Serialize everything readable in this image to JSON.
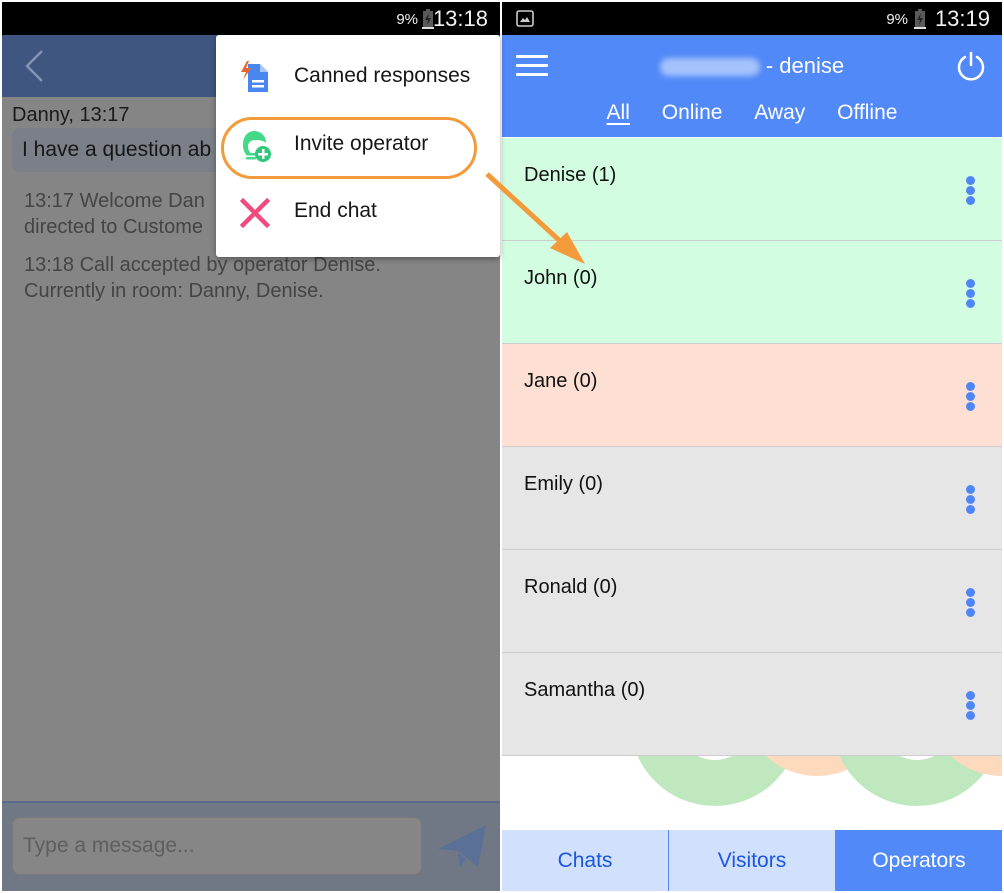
{
  "colors": {
    "accent": "#5289f8",
    "highlight_orange": "#f39a3a",
    "online_row": "#d3fde1",
    "away_row": "#fde0d3",
    "offline_row": "#e6e6e6",
    "dim_overlay": "#858585"
  },
  "left_screen": {
    "status_bar": {
      "battery": "9%",
      "time": "13:18"
    },
    "header": {
      "back_icon": "chevron-left-icon"
    },
    "chat": {
      "sender": "Danny, 13:17",
      "visitor_message": "I have a question ab",
      "system_messages": [
        {
          "line1": "13:17 Welcome Dan",
          "line2": "directed to Custome"
        },
        {
          "line1": "13:18 Call accepted by operator Denise.",
          "line2": "Currently in room: Danny, Denise."
        }
      ]
    },
    "composer": {
      "placeholder": "Type a message...",
      "send_icon": "paper-plane-icon"
    },
    "menu": {
      "items": [
        {
          "label": "Canned responses",
          "icon": "canned-responses-icon"
        },
        {
          "label": "Invite operator",
          "icon": "invite-operator-icon",
          "highlighted": true
        },
        {
          "label": "End chat",
          "icon": "close-x-icon"
        }
      ]
    }
  },
  "right_screen": {
    "status_bar": {
      "battery": "9%",
      "time": "13:19",
      "notification_icon": "image-icon"
    },
    "header": {
      "title_suffix": "- denise",
      "menu_icon": "hamburger-icon",
      "power_icon": "power-icon"
    },
    "filters": [
      {
        "label": "All",
        "active": true
      },
      {
        "label": "Online",
        "active": false
      },
      {
        "label": "Away",
        "active": false
      },
      {
        "label": "Offline",
        "active": false
      }
    ],
    "operators": [
      {
        "name": "Denise (1)",
        "status": "online"
      },
      {
        "name": "John (0)",
        "status": "online"
      },
      {
        "name": "Jane (0)",
        "status": "away"
      },
      {
        "name": "Emily (0)",
        "status": "offline"
      },
      {
        "name": "Ronald (0)",
        "status": "offline"
      },
      {
        "name": "Samantha (0)",
        "status": "offline"
      }
    ],
    "bottom_tabs": [
      {
        "label": "Chats",
        "active": false
      },
      {
        "label": "Visitors",
        "active": false
      },
      {
        "label": "Operators",
        "active": true
      }
    ]
  }
}
